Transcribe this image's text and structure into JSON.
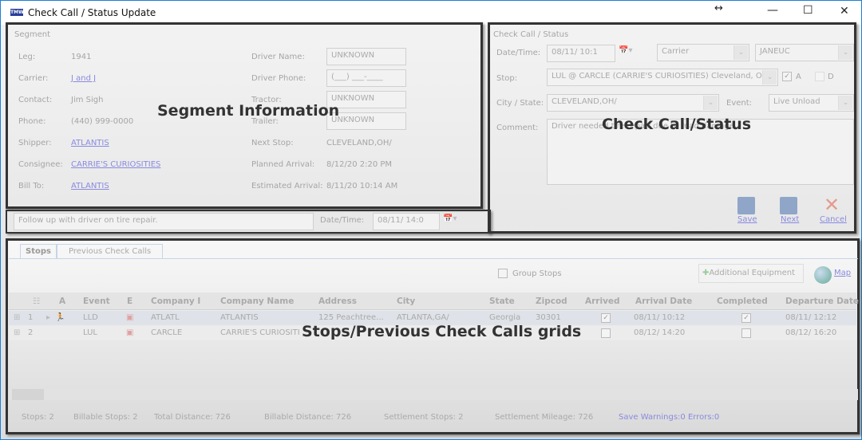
{
  "window": {
    "title": "Check Call / Status Update",
    "logo": "TMW",
    "controls": {
      "resize": "↔",
      "minimize": "—",
      "maximize": "☐",
      "close": "✕"
    }
  },
  "segment": {
    "legend": "Segment",
    "overlay": "Segment Information",
    "left": [
      {
        "label": "Leg:",
        "value": "1941",
        "link": false
      },
      {
        "label": "Carrier:",
        "value": "J and J",
        "link": true
      },
      {
        "label": "Contact:",
        "value": "Jim Sigh",
        "link": false
      },
      {
        "label": "Phone:",
        "value": "(440) 999-0000",
        "link": false
      },
      {
        "label": "Shipper:",
        "value": "ATLANTIS",
        "link": true
      },
      {
        "label": "Consignee:",
        "value": "CARRIE'S CURIOSITIES",
        "link": true
      },
      {
        "label": "Bill To:",
        "value": "ATLANTIS",
        "link": true
      }
    ],
    "right": [
      {
        "label": "Driver Name:",
        "value": "UNKNOWN"
      },
      {
        "label": "Driver Phone:",
        "value": "(___) ___-____"
      },
      {
        "label": "Tractor:",
        "value": "UNKNOWN"
      },
      {
        "label": "Trailer:",
        "value": "UNKNOWN"
      },
      {
        "label": "Next Stop:",
        "value": "CLEVELAND,OH/"
      },
      {
        "label": "Planned Arrival:",
        "value": "8/12/20   2:20 PM"
      },
      {
        "label": "Estimated Arrival:",
        "value": "8/11/20   10:14 AM"
      }
    ]
  },
  "followup": {
    "text": "Follow up with driver on tire repair.",
    "datetime_label": "Date/Time:",
    "datetime_value": "08/11/   14:0"
  },
  "checkcall": {
    "legend": "Check Call / Status",
    "overlay": "Check Call/Status",
    "datetime_label": "Date/Time:",
    "datetime_value": "08/11/   10:1",
    "carrier_placeholder": "Carrier",
    "carrier_value": "JANEUC",
    "stop_label": "Stop:",
    "stop_value": "LUL @ CARCLE (CARRIE'S CURIOSITIES) Cleveland, OH",
    "arrived_label": "A",
    "arrived_checked": true,
    "departed_label": "D",
    "departed_checked": false,
    "city_label": "City / State:",
    "city_value": "CLEVELAND,OH/",
    "event_label": "Event:",
    "event_value": "Live Unload",
    "comment_label": "Comment:",
    "comment_value": "Driver needed tire repair due to road damage.",
    "save": "Save",
    "next": "Next",
    "cancel": "Cancel"
  },
  "grid": {
    "overlay": "Stops/Previous Check Calls grids",
    "tabs": [
      "Stops",
      "Previous Check Calls"
    ],
    "group_stops": "Group Stops",
    "additional_equipment": "Additional Equipment",
    "map": "Map",
    "columns": [
      "A",
      "Event",
      "E",
      "Company I",
      "Company Name",
      "Address",
      "City",
      "State",
      "Zipcod",
      "Arrived",
      "Arrival Date",
      "Completed",
      "Departure Date"
    ],
    "rows": [
      {
        "num": "1",
        "event": "LLD",
        "company_id": "ATLATL",
        "company_name": "ATLANTIS",
        "address": "125 Peachtree...",
        "city": "ATLANTA,GA/",
        "state": "Georgia",
        "zip": "30301",
        "arrived": true,
        "arrival": "08/11/   10:12",
        "completed": true,
        "departure": "08/11/   12:12"
      },
      {
        "num": "2",
        "event": "LUL",
        "company_id": "CARCLE",
        "company_name": "CARRIE'S CURIOSITI",
        "address": "",
        "city": "",
        "state": "",
        "zip": "",
        "arrived": false,
        "arrival": "08/12/   14:20",
        "completed": false,
        "departure": "08/12/   16:20"
      }
    ]
  },
  "status": {
    "stops": "Stops: 2",
    "billable_stops": "Billable Stops: 2",
    "total_distance": "Total Distance: 726",
    "billable_distance": "Billable Distance: 726",
    "settlement_stops": "Settlement Stops: 2",
    "settlement_mileage": "Settlement Mileage: 726",
    "warnings": "Save Warnings:0 Errors:0"
  }
}
